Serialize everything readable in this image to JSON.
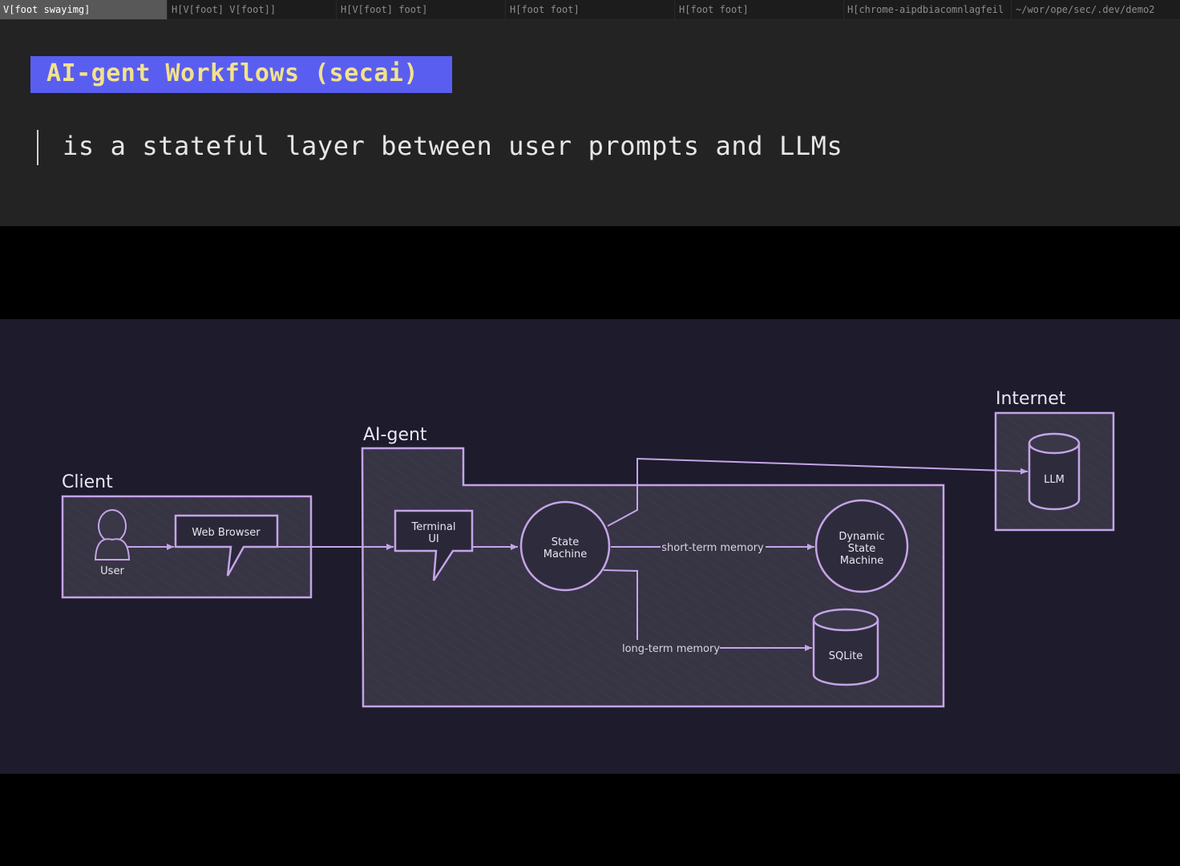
{
  "tabs": [
    {
      "label": "V[foot swayimg]",
      "active": true
    },
    {
      "label": "H[V[foot] V[foot]]",
      "active": false
    },
    {
      "label": "H[V[foot] foot]",
      "active": false
    },
    {
      "label": "H[foot foot]",
      "active": false
    },
    {
      "label": "H[foot foot]",
      "active": false
    },
    {
      "label": "H[chrome-aipdbiacomnlagfeil",
      "active": false
    },
    {
      "label": "~/wor/ope/sec/.dev/demo2",
      "active": false
    }
  ],
  "slide": {
    "title": "AI-gent Workflows (secai)",
    "quote": "is a stateful layer between user prompts and LLMs"
  },
  "diagram": {
    "client": {
      "label": "Client",
      "user": "User",
      "browser": "Web Browser"
    },
    "aigent": {
      "label": "AI-gent",
      "terminal_line1": "Terminal",
      "terminal_line2": "UI",
      "state_line1": "State",
      "state_line2": "Machine",
      "dyn_line1": "Dynamic",
      "dyn_line2": "State",
      "dyn_line3": "Machine",
      "sqlite": "SQLite",
      "short_term": "short-term memory",
      "long_term": "long-term memory"
    },
    "internet": {
      "label": "Internet",
      "llm": "LLM"
    }
  },
  "colors": {
    "diagram_bg": "#1d1b2c",
    "stroke": "#c4a4e8",
    "box_fill": "#3a3747",
    "title_bg": "#5a5ef0",
    "title_fg": "#f3e38a"
  }
}
